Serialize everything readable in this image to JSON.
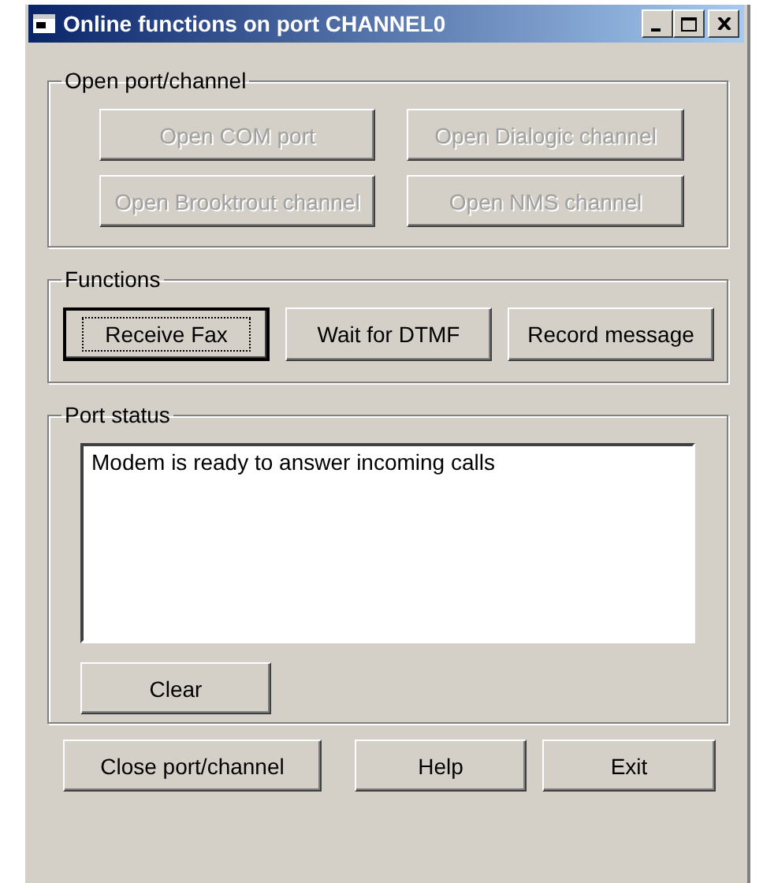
{
  "window": {
    "title": "Online functions on port CHANNEL0"
  },
  "open_group": {
    "label": "Open port/channel",
    "buttons": [
      {
        "label": "Open COM port",
        "disabled": true
      },
      {
        "label": "Open Dialogic channel",
        "disabled": true
      },
      {
        "label": "Open Brooktrout channel",
        "disabled": true
      },
      {
        "label": "Open NMS channel",
        "disabled": true
      }
    ]
  },
  "functions_group": {
    "label": "Functions",
    "buttons": [
      {
        "label": "Receive Fax",
        "focused": true
      },
      {
        "label": "Wait for DTMF",
        "focused": false
      },
      {
        "label": "Record message",
        "focused": false
      }
    ]
  },
  "status_group": {
    "label": "Port status",
    "text": "Modem is ready to answer incoming calls",
    "clear_button": "Clear"
  },
  "bottom_buttons": [
    "Close port/channel",
    "Help",
    "Exit"
  ]
}
